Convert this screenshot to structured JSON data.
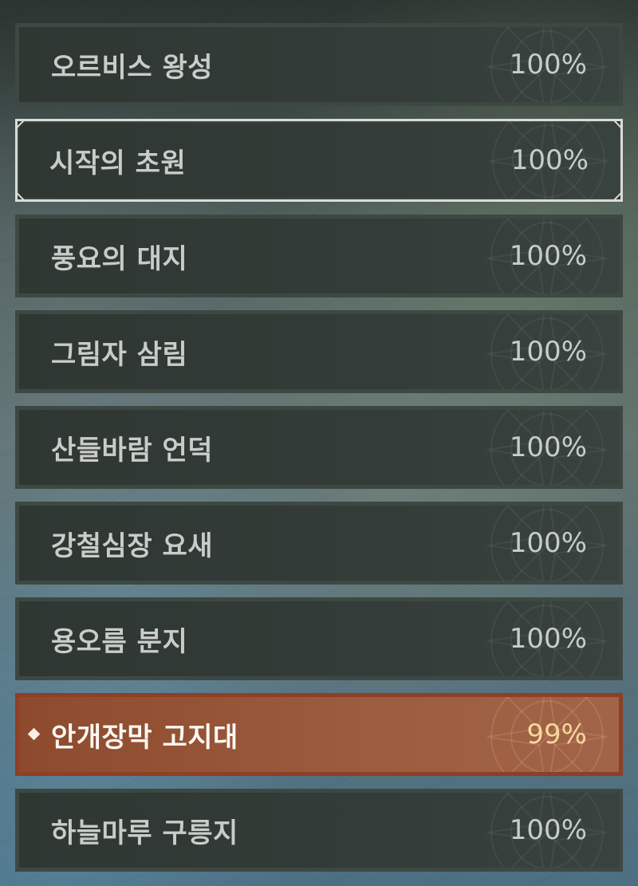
{
  "regions": [
    {
      "name": "오르비스 왕성",
      "progress": "100%",
      "state": "normal"
    },
    {
      "name": "시작의 초원",
      "progress": "100%",
      "state": "selected"
    },
    {
      "name": "풍요의 대지",
      "progress": "100%",
      "state": "normal"
    },
    {
      "name": "그림자 삼림",
      "progress": "100%",
      "state": "normal"
    },
    {
      "name": "산들바람 언덕",
      "progress": "100%",
      "state": "normal"
    },
    {
      "name": "강철심장 요새",
      "progress": "100%",
      "state": "normal"
    },
    {
      "name": "용오름 분지",
      "progress": "100%",
      "state": "normal"
    },
    {
      "name": "안개장막 고지대",
      "progress": "99%",
      "state": "active"
    },
    {
      "name": "하늘마루 구릉지",
      "progress": "100%",
      "state": "normal"
    }
  ],
  "icons": {
    "row_ornament": "compass-rose-icon",
    "active_marker": "diamond-marker-icon"
  },
  "colors": {
    "row_background": "#333c38",
    "row_border": "#3e4843",
    "selected_border": "#d9dcd8",
    "active_background": "#9b5b3f",
    "active_border": "#8e3f25",
    "active_percent": "#f6d79b",
    "text": "#c9ccc8"
  }
}
